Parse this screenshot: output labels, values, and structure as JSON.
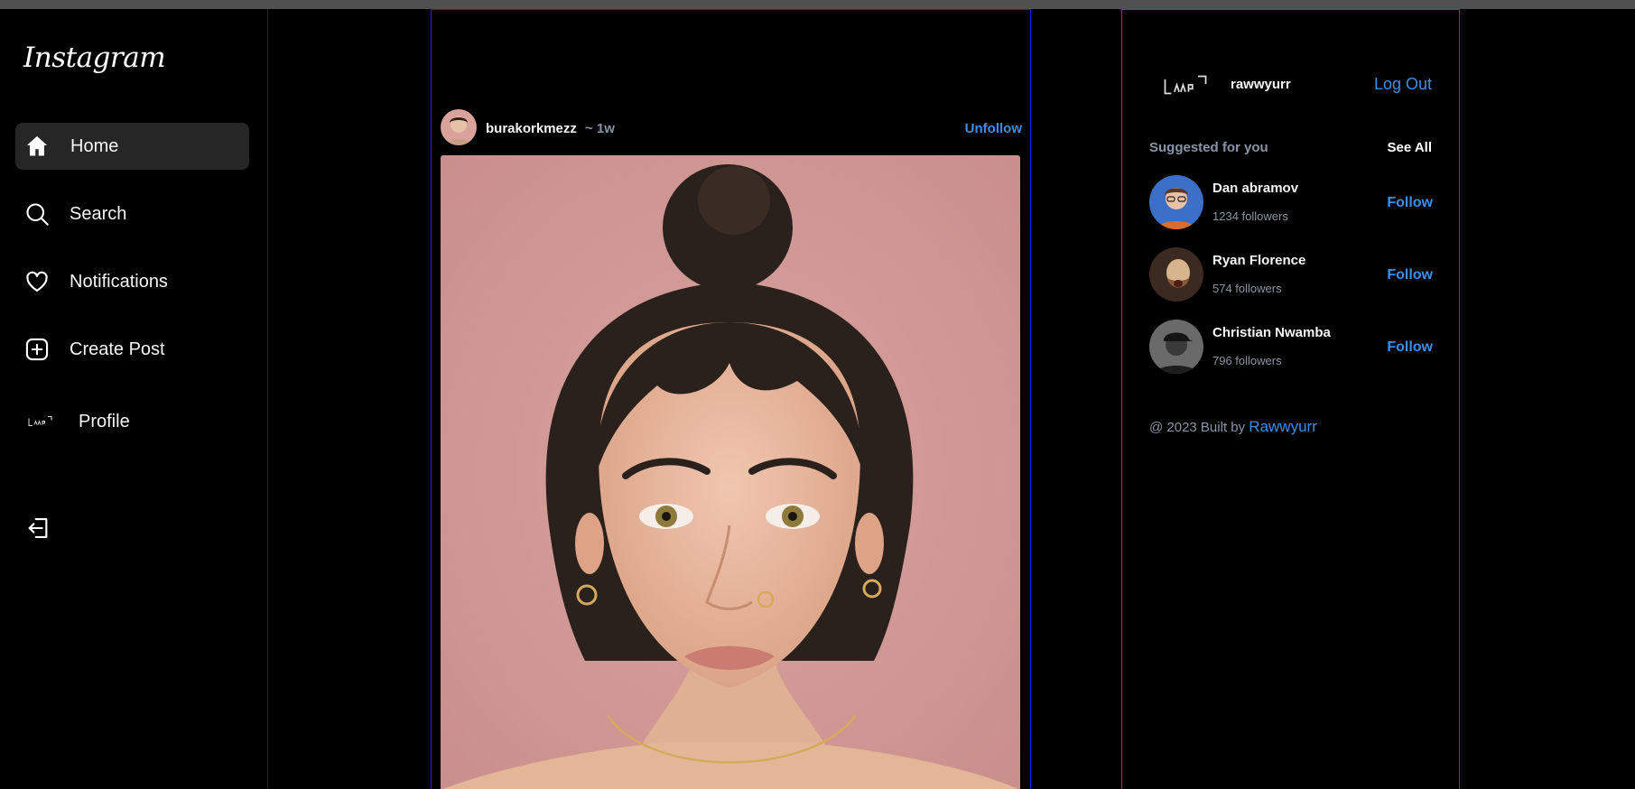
{
  "app": {
    "logo": "Instagram"
  },
  "sidebar": {
    "items": [
      {
        "label": "Home",
        "icon": "home-icon",
        "active": true
      },
      {
        "label": "Search",
        "icon": "search-icon"
      },
      {
        "label": "Notifications",
        "icon": "heart-icon"
      },
      {
        "label": "Create Post",
        "icon": "plus-square-icon"
      },
      {
        "label": "Profile",
        "icon": "profile-avatar-icon"
      }
    ],
    "logout_icon": "logout-icon"
  },
  "post": {
    "username": "burakorkmezz",
    "time": "~ 1w",
    "action": "Unfollow"
  },
  "right": {
    "username": "rawwyurr",
    "logout": "Log Out",
    "suggested_title": "Suggested for you",
    "see_all": "See All",
    "suggestions": [
      {
        "name": "Dan abramov",
        "followers": "1234 followers",
        "action": "Follow"
      },
      {
        "name": "Ryan Florence",
        "followers": "574 followers",
        "action": "Follow"
      },
      {
        "name": "Christian Nwamba",
        "followers": "796 followers",
        "action": "Follow"
      }
    ],
    "footer_prefix": "@ 2023 Built by",
    "footer_credit": "Rawwyurr"
  },
  "colors": {
    "accent": "#3d8ee6",
    "muted": "#8a94a6",
    "feed_border": "#1a1ae6",
    "panel_border": "#c81e1e",
    "active_bg": "#262626"
  }
}
